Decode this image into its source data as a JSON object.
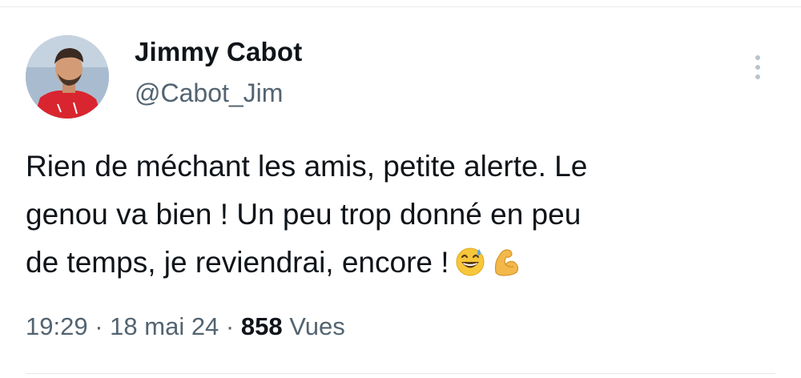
{
  "author": {
    "display_name": "Jimmy Cabot",
    "handle": "@Cabot_Jim",
    "avatar": "profile-photo"
  },
  "tweet": {
    "lines": [
      "Rien de méchant les amis, petite alerte. Le",
      "genou va bien ! Un peu trop donné en peu",
      "de temps, je reviendrai, encore !"
    ],
    "emojis": [
      "grinning-sweat-emoji",
      "flexed-biceps-emoji"
    ]
  },
  "meta": {
    "time": "19:29",
    "separator": "·",
    "date": "18 mai 24",
    "views_count": "858",
    "views_label": "Vues"
  },
  "icons": {
    "more": "more-vertical-icon"
  },
  "colors": {
    "text_primary": "#0f1419",
    "text_secondary": "#536471",
    "divider": "#e6e9ec"
  }
}
